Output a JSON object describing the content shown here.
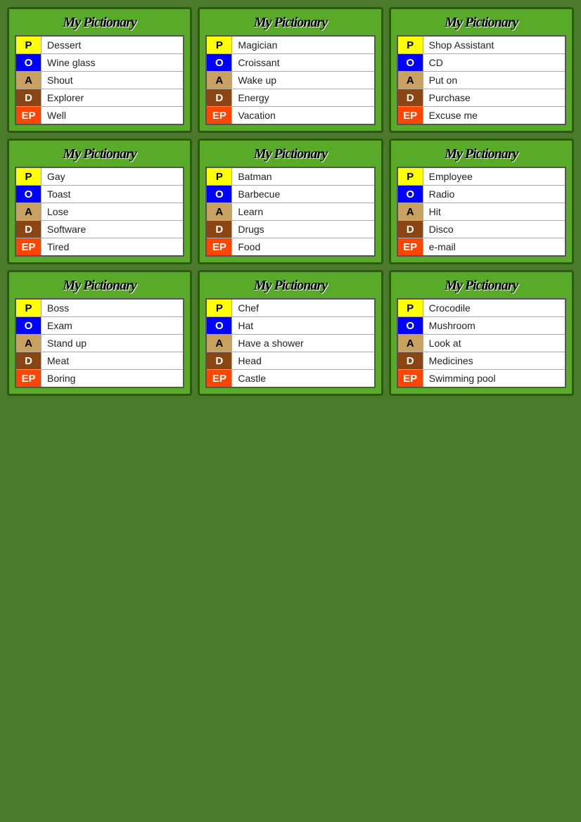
{
  "cards": [
    {
      "title": "My Pictionary",
      "rows": [
        {
          "letter": "P",
          "type": "p",
          "word": "Dessert"
        },
        {
          "letter": "O",
          "type": "o",
          "word": "Wine glass"
        },
        {
          "letter": "A",
          "type": "a",
          "word": "Shout"
        },
        {
          "letter": "D",
          "type": "d",
          "word": "Explorer"
        },
        {
          "letter": "EP",
          "type": "ep",
          "word": "Well"
        }
      ]
    },
    {
      "title": "My Pictionary",
      "rows": [
        {
          "letter": "P",
          "type": "p",
          "word": "Magician"
        },
        {
          "letter": "O",
          "type": "o",
          "word": "Croissant"
        },
        {
          "letter": "A",
          "type": "a",
          "word": "Wake up"
        },
        {
          "letter": "D",
          "type": "d",
          "word": "Energy"
        },
        {
          "letter": "EP",
          "type": "ep",
          "word": "Vacation"
        }
      ]
    },
    {
      "title": "My Pictionary",
      "rows": [
        {
          "letter": "P",
          "type": "p",
          "word": "Shop Assistant"
        },
        {
          "letter": "O",
          "type": "o",
          "word": "CD"
        },
        {
          "letter": "A",
          "type": "a",
          "word": "Put on"
        },
        {
          "letter": "D",
          "type": "d",
          "word": "Purchase"
        },
        {
          "letter": "EP",
          "type": "ep",
          "word": "Excuse me"
        }
      ]
    },
    {
      "title": "My Pictionary",
      "rows": [
        {
          "letter": "P",
          "type": "p",
          "word": "Gay"
        },
        {
          "letter": "O",
          "type": "o",
          "word": "Toast"
        },
        {
          "letter": "A",
          "type": "a",
          "word": "Lose"
        },
        {
          "letter": "D",
          "type": "d",
          "word": "Software"
        },
        {
          "letter": "EP",
          "type": "ep",
          "word": "Tired"
        }
      ]
    },
    {
      "title": "My Pictionary",
      "rows": [
        {
          "letter": "P",
          "type": "p",
          "word": "Batman"
        },
        {
          "letter": "O",
          "type": "o",
          "word": "Barbecue"
        },
        {
          "letter": "A",
          "type": "a",
          "word": "Learn"
        },
        {
          "letter": "D",
          "type": "d",
          "word": "Drugs"
        },
        {
          "letter": "EP",
          "type": "ep",
          "word": "Food"
        }
      ]
    },
    {
      "title": "My Pictionary",
      "rows": [
        {
          "letter": "P",
          "type": "p",
          "word": "Employee"
        },
        {
          "letter": "O",
          "type": "o",
          "word": "Radio"
        },
        {
          "letter": "A",
          "type": "a",
          "word": "Hit"
        },
        {
          "letter": "D",
          "type": "d",
          "word": "Disco"
        },
        {
          "letter": "EP",
          "type": "ep",
          "word": "e-mail"
        }
      ]
    },
    {
      "title": "My Pictionary",
      "rows": [
        {
          "letter": "P",
          "type": "p",
          "word": "Boss"
        },
        {
          "letter": "O",
          "type": "o",
          "word": "Exam"
        },
        {
          "letter": "A",
          "type": "a",
          "word": "Stand up"
        },
        {
          "letter": "D",
          "type": "d",
          "word": "Meat"
        },
        {
          "letter": "EP",
          "type": "ep",
          "word": "Boring"
        }
      ]
    },
    {
      "title": "My Pictionary",
      "rows": [
        {
          "letter": "P",
          "type": "p",
          "word": "Chef"
        },
        {
          "letter": "O",
          "type": "o",
          "word": "Hat"
        },
        {
          "letter": "A",
          "type": "a",
          "word": "Have a shower"
        },
        {
          "letter": "D",
          "type": "d",
          "word": "Head"
        },
        {
          "letter": "EP",
          "type": "ep",
          "word": "Castle"
        }
      ]
    },
    {
      "title": "My Pictionary",
      "rows": [
        {
          "letter": "P",
          "type": "p",
          "word": "Crocodile"
        },
        {
          "letter": "O",
          "type": "o",
          "word": "Mushroom"
        },
        {
          "letter": "A",
          "type": "a",
          "word": "Look at"
        },
        {
          "letter": "D",
          "type": "d",
          "word": "Medicines"
        },
        {
          "letter": "EP",
          "type": "ep",
          "word": "Swimming pool"
        }
      ]
    }
  ]
}
